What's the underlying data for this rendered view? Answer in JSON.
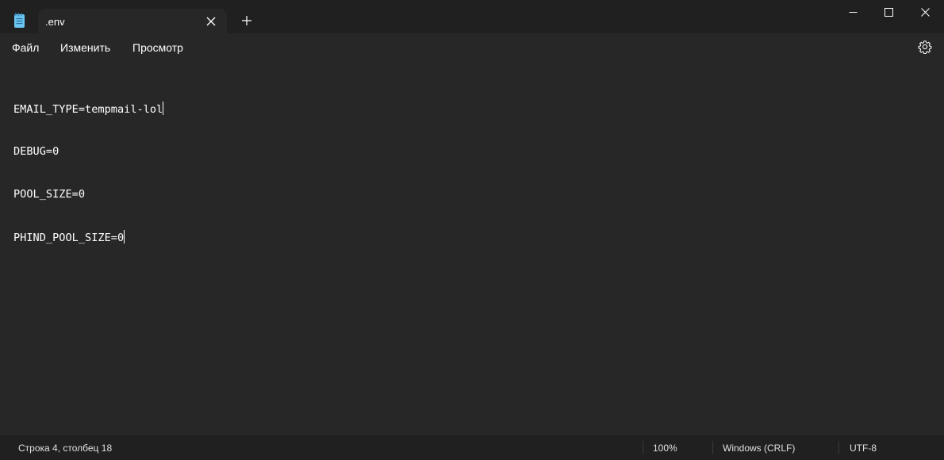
{
  "tab": {
    "title": ".env"
  },
  "menu": {
    "file": "Файл",
    "edit": "Изменить",
    "view": "Просмотр"
  },
  "editor": {
    "lines": [
      "EMAIL_TYPE=tempmail-lol",
      "DEBUG=0",
      "POOL_SIZE=0",
      "PHIND_POOL_SIZE=0"
    ]
  },
  "status": {
    "position": "Строка 4, столбец 18",
    "zoom": "100%",
    "line_ending": "Windows (CRLF)",
    "encoding": "UTF-8"
  },
  "icons": {
    "app": "notepad-icon",
    "tab_close": "close-icon",
    "new_tab": "plus-icon",
    "minimize": "minimize-icon",
    "maximize": "maximize-icon",
    "close": "close-icon",
    "settings": "gear-icon"
  },
  "colors": {
    "background": "#202020",
    "editor": "#272727",
    "app_icon": "#6cc6f2"
  }
}
